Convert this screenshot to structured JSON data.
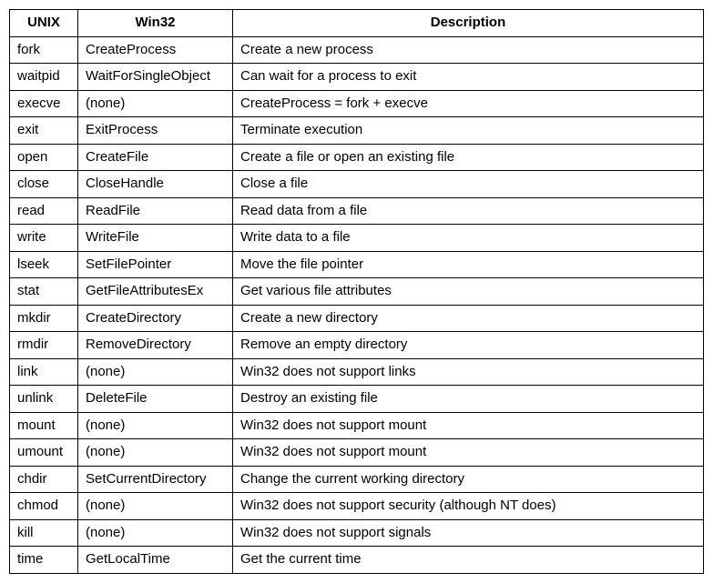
{
  "chart_data": {
    "type": "table",
    "headers": [
      "UNIX",
      "Win32",
      "Description"
    ],
    "rows": [
      {
        "unix": "fork",
        "win32": "CreateProcess",
        "desc": "Create a new process"
      },
      {
        "unix": "waitpid",
        "win32": "WaitForSingleObject",
        "desc": "Can wait for a process to exit"
      },
      {
        "unix": "execve",
        "win32": "(none)",
        "desc": "CreateProcess = fork + execve"
      },
      {
        "unix": "exit",
        "win32": "ExitProcess",
        "desc": "Terminate execution"
      },
      {
        "unix": "open",
        "win32": "CreateFile",
        "desc": "Create a file or open an existing file"
      },
      {
        "unix": "close",
        "win32": "CloseHandle",
        "desc": "Close a file"
      },
      {
        "unix": "read",
        "win32": "ReadFile",
        "desc": "Read data from a file"
      },
      {
        "unix": "write",
        "win32": "WriteFile",
        "desc": "Write data to a file"
      },
      {
        "unix": "lseek",
        "win32": "SetFilePointer",
        "desc": "Move the file pointer"
      },
      {
        "unix": "stat",
        "win32": "GetFileAttributesEx",
        "desc": "Get various file attributes"
      },
      {
        "unix": "mkdir",
        "win32": "CreateDirectory",
        "desc": "Create a new directory"
      },
      {
        "unix": "rmdir",
        "win32": "RemoveDirectory",
        "desc": "Remove an empty directory"
      },
      {
        "unix": "link",
        "win32": "(none)",
        "desc": "Win32 does not support links"
      },
      {
        "unix": "unlink",
        "win32": "DeleteFile",
        "desc": "Destroy an existing file"
      },
      {
        "unix": "mount",
        "win32": "(none)",
        "desc": "Win32 does not support mount"
      },
      {
        "unix": "umount",
        "win32": "(none)",
        "desc": "Win32 does not support mount"
      },
      {
        "unix": "chdir",
        "win32": "SetCurrentDirectory",
        "desc": "Change the current working directory"
      },
      {
        "unix": "chmod",
        "win32": "(none)",
        "desc": "Win32 does not support security (although NT does)"
      },
      {
        "unix": "kill",
        "win32": "(none)",
        "desc": "Win32 does not support signals"
      },
      {
        "unix": "time",
        "win32": "GetLocalTime",
        "desc": "Get the current time"
      }
    ]
  }
}
